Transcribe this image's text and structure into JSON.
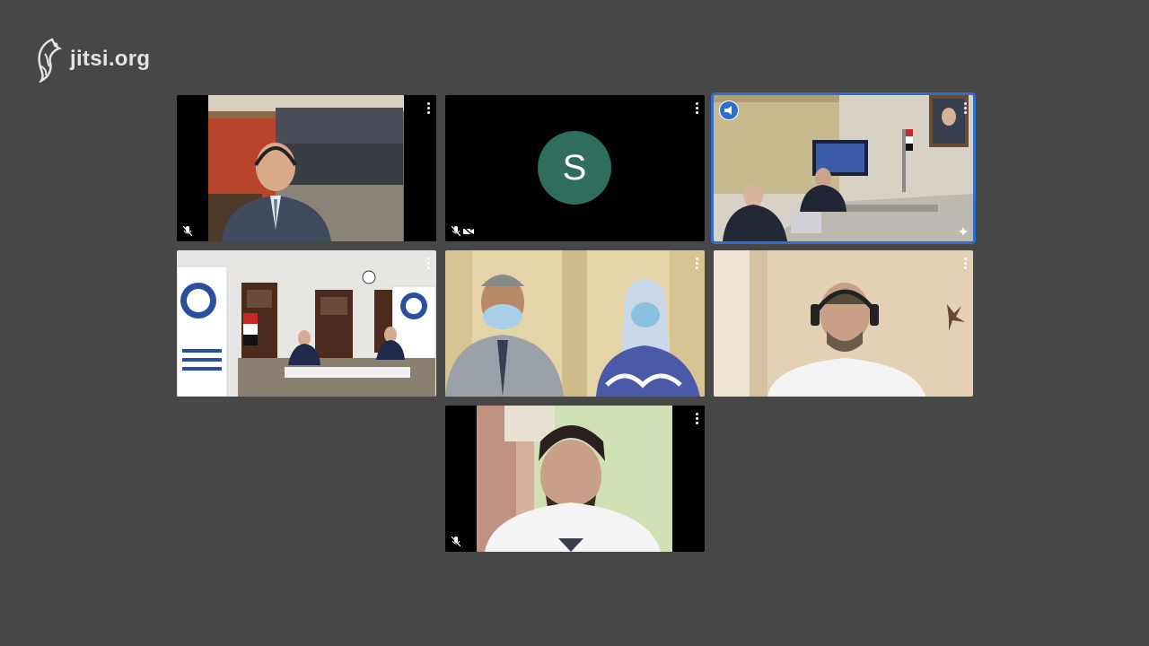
{
  "app": {
    "logo_text": "jitsi.org"
  },
  "theme": {
    "background": "#474747",
    "active_border": "#2d6fcf",
    "avatar_bg": "#2f6e5d"
  },
  "tiles": [
    {
      "id": "t1",
      "audio_muted": true,
      "video_muted": false
    },
    {
      "id": "t2",
      "avatar_letter": "S",
      "audio_muted": true,
      "video_muted": true
    },
    {
      "id": "t3",
      "dominant_speaker": true,
      "audio_muted": false,
      "video_muted": false
    },
    {
      "id": "t4",
      "audio_muted": false,
      "video_muted": false
    },
    {
      "id": "t5",
      "audio_muted": false,
      "video_muted": false
    },
    {
      "id": "t6",
      "audio_muted": false,
      "video_muted": false
    },
    {
      "id": "t7",
      "audio_muted": true,
      "video_muted": false
    }
  ],
  "icons": {
    "logo": "jitsi-logo-icon",
    "menu": "more-options-icon",
    "mic_muted": "mic-muted-icon",
    "cam_muted": "camera-muted-icon",
    "dominant": "dominant-speaker-icon",
    "pin": "pin-icon"
  }
}
